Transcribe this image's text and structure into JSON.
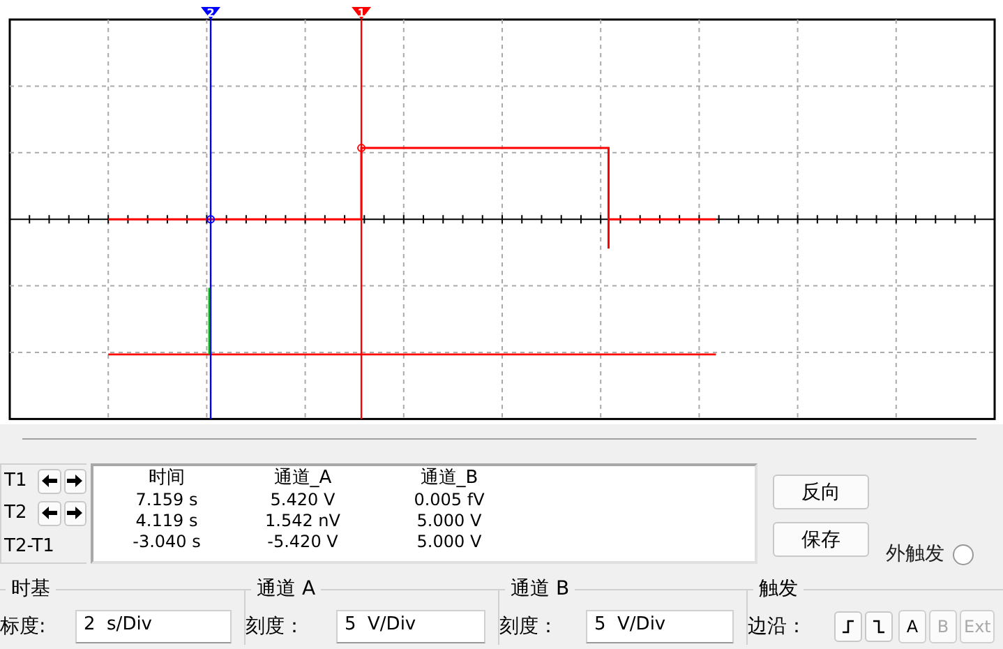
{
  "plot": {
    "cursors": [
      {
        "label": "2",
        "color": "#0000ff"
      },
      {
        "label": "1",
        "color": "#ff0000"
      }
    ]
  },
  "cursor_rows": [
    {
      "label": "T1",
      "arrows": true
    },
    {
      "label": "T2",
      "arrows": true
    },
    {
      "label": "T2-T1",
      "arrows": false
    }
  ],
  "readout": {
    "columns": [
      "时间",
      "通道_A",
      "通道_B"
    ],
    "rows": [
      [
        "7.159 s",
        "5.420 V",
        "0.005 fV"
      ],
      [
        "4.119 s",
        "1.542 nV",
        "5.000 V"
      ],
      [
        "-3.040 s",
        "-5.420 V",
        "5.000 V"
      ]
    ]
  },
  "buttons": [
    "反向",
    "保存"
  ],
  "external_trigger": {
    "label": "外触发",
    "selected": false
  },
  "timebase": {
    "title": "时基",
    "scale_label": "标度:",
    "scale": "2  s/Div"
  },
  "channel_a": {
    "title": "通道 A",
    "scale_label": "刻度：",
    "scale": "5  V/Div"
  },
  "channel_b": {
    "title": "通道 B",
    "scale_label": "刻度：",
    "scale": "5  V/Div"
  },
  "trigger": {
    "title": "触发",
    "edge_label": "边沿：",
    "edges": [
      {
        "kind": "rising"
      },
      {
        "kind": "falling"
      }
    ],
    "sources": [
      {
        "label": "A",
        "disabled": false
      },
      {
        "label": "B",
        "disabled": true
      },
      {
        "label": "Ext",
        "disabled": true
      }
    ]
  }
}
